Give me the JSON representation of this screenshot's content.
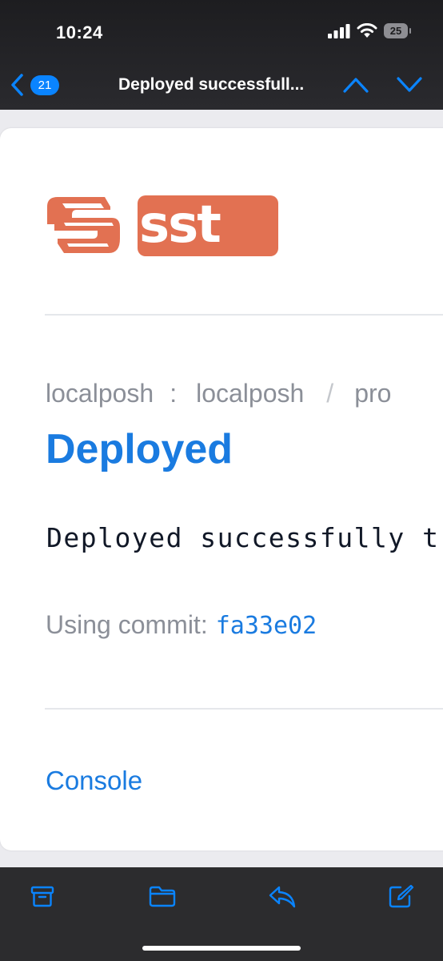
{
  "status_bar": {
    "time": "10:24",
    "battery": "25"
  },
  "nav": {
    "unread_count": "21",
    "title": "Deployed successfull...",
    "accent": "#0a84ff"
  },
  "email": {
    "brand_logo_text": "sst",
    "brand_color": "#e27152",
    "breadcrumb": {
      "org": "localposh",
      "separator": ":",
      "app": "localposh",
      "slash": "/",
      "stage": "pro"
    },
    "heading": "Deployed",
    "message": "Deployed successfully t",
    "commit_label": "Using commit:",
    "commit_hash": "fa33e02",
    "console_link": "Console",
    "link_color": "#1a7be0"
  },
  "toolbar": {
    "icons": [
      "archive-icon",
      "folder-icon",
      "reply-icon",
      "compose-icon"
    ]
  }
}
